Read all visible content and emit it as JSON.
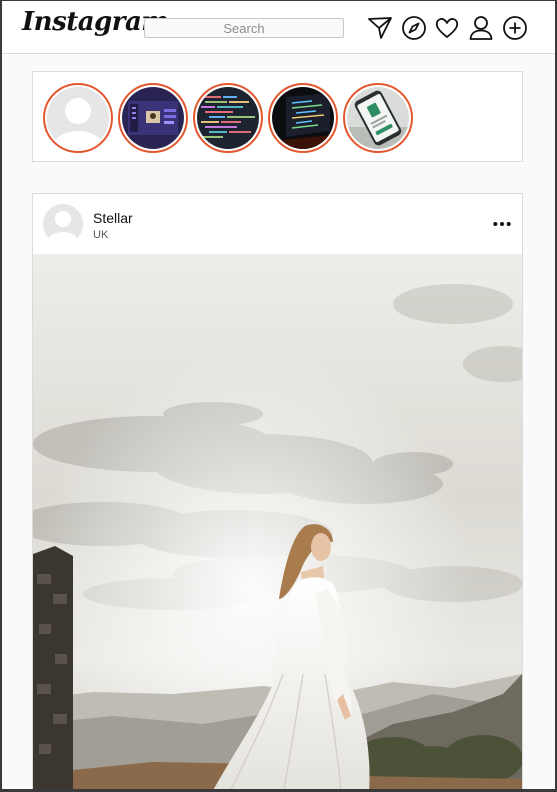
{
  "app": {
    "logo_text": "Instagram"
  },
  "header": {
    "search_placeholder": "Search",
    "icons": [
      "send-icon",
      "explore-compass-icon",
      "heart-icon",
      "profile-icon",
      "add-post-icon"
    ]
  },
  "stories": {
    "items": [
      {
        "name": "story-default-avatar"
      },
      {
        "name": "story-purple-app-screen"
      },
      {
        "name": "story-code-screen"
      },
      {
        "name": "story-dark-laptop"
      },
      {
        "name": "story-phone-app"
      }
    ],
    "ring_color": "#e4572e"
  },
  "post": {
    "username": "Stellar",
    "location": "UK",
    "image_description": "woman-in-white-dress-on-hilltop"
  }
}
